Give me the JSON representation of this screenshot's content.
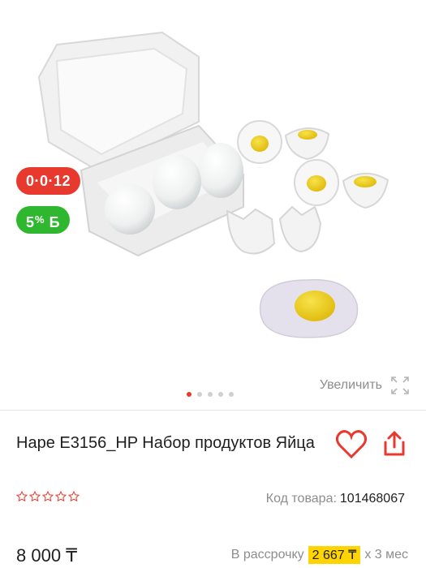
{
  "badges": {
    "installment": "0·0·12",
    "bonus_value": "5",
    "bonus_percent": "%",
    "bonus_symbol": "Б"
  },
  "gallery": {
    "zoom_label": "Увеличить",
    "images_total": 5,
    "active_index": 0
  },
  "product": {
    "title": "Hape E3156_HP Набор продуктов Яйца",
    "rating_stars": 0,
    "code_label": "Код товара:",
    "code_value": "101468067"
  },
  "pricing": {
    "price": "8 000 ₸",
    "installment_label": "В рассрочку",
    "installment_amount": "2 667 ₸",
    "installment_term": "х 3 мес"
  },
  "colors": {
    "accent_red": "#e8392f",
    "bonus_green": "#2fb82f",
    "installment_highlight": "#ffd400"
  }
}
